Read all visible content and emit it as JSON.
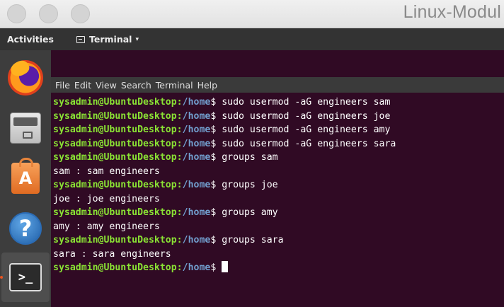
{
  "window": {
    "title": "Linux-Modul"
  },
  "top_panel": {
    "activities": "Activities",
    "app_menu": "Terminal",
    "app_menu_caret": "▾"
  },
  "dock": {
    "items": [
      {
        "name": "firefox-icon"
      },
      {
        "name": "files-icon"
      },
      {
        "name": "software-store-icon",
        "glyph": "A"
      },
      {
        "name": "help-icon",
        "glyph": "?"
      },
      {
        "name": "terminal-icon",
        "glyph": ">_"
      }
    ],
    "accent": "#e95420"
  },
  "terminal": {
    "menu": [
      "File",
      "Edit",
      "View",
      "Search",
      "Terminal",
      "Help"
    ],
    "prompt": {
      "user": "sysadmin@UbuntuDesktop",
      "sep": ":",
      "path": "/home",
      "symbol": "$ "
    },
    "lines": [
      {
        "type": "cmd",
        "text": "sudo usermod -aG engineers sam"
      },
      {
        "type": "cmd",
        "text": "sudo usermod -aG engineers joe"
      },
      {
        "type": "cmd",
        "text": "sudo usermod -aG engineers amy"
      },
      {
        "type": "cmd",
        "text": "sudo usermod -aG engineers sara"
      },
      {
        "type": "cmd",
        "text": "groups sam"
      },
      {
        "type": "out",
        "text": "sam : sam engineers"
      },
      {
        "type": "cmd",
        "text": "groups joe"
      },
      {
        "type": "out",
        "text": "joe : joe engineers"
      },
      {
        "type": "cmd",
        "text": "groups amy"
      },
      {
        "type": "out",
        "text": "amy : amy engineers"
      },
      {
        "type": "cmd",
        "text": "groups sara"
      },
      {
        "type": "out",
        "text": "sara : sara engineers"
      },
      {
        "type": "cmd",
        "text": ""
      }
    ],
    "colors": {
      "background": "#300a24",
      "user": "#8ae234",
      "path": "#729fcf",
      "text": "#ffffff"
    }
  }
}
